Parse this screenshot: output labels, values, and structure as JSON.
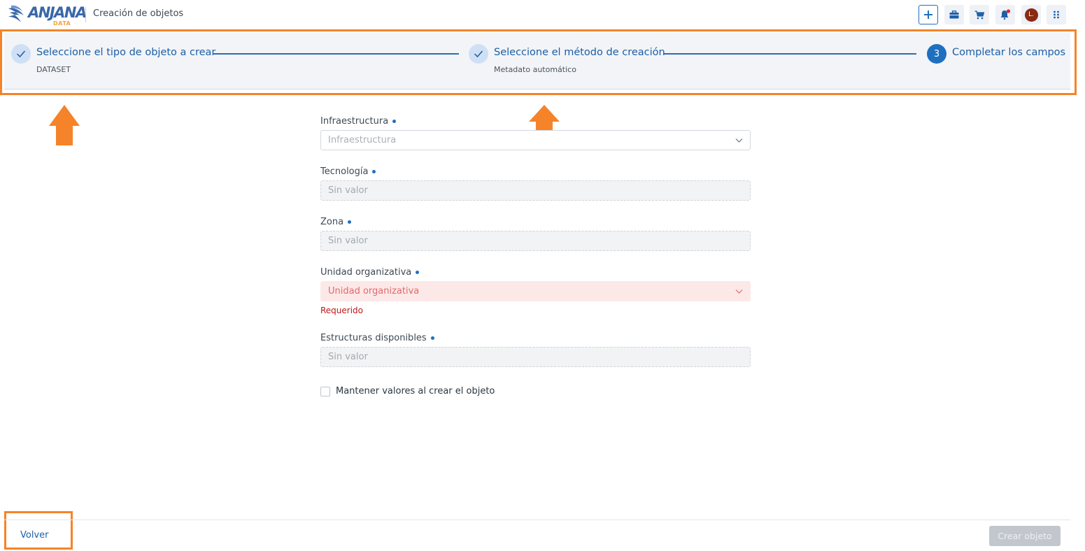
{
  "header": {
    "logo_text": "ANJANA",
    "logo_sub": "DATA",
    "title": "Creación de objetos"
  },
  "toolbar": {
    "icons": [
      "plus-icon",
      "briefcase-icon",
      "cart-icon",
      "bell-icon",
      "avatar",
      "apps-grid-icon"
    ],
    "avatar_initial": "L."
  },
  "stepper": {
    "steps": [
      {
        "label": "Seleccione el tipo de objeto a crear",
        "sub": "DATASET",
        "state": "done"
      },
      {
        "label": "Seleccione el método de creación",
        "sub": "Metadato automático",
        "state": "done"
      },
      {
        "number": "3",
        "label": "Completar los campos",
        "state": "active"
      }
    ]
  },
  "form": {
    "fields": [
      {
        "label": "Infraestructura",
        "placeholder": "Infraestructura",
        "type": "select"
      },
      {
        "label": "Tecnología",
        "placeholder": "Sin valor",
        "type": "disabled"
      },
      {
        "label": "Zona",
        "placeholder": "Sin valor",
        "type": "disabled"
      },
      {
        "label": "Unidad organizativa",
        "placeholder": "Unidad organizativa",
        "type": "select-error",
        "error": "Requerido"
      },
      {
        "label": "Estructuras disponibles",
        "placeholder": "Sin valor",
        "type": "disabled"
      }
    ],
    "keep_values_label": "Mantener valores al crear el objeto"
  },
  "footer": {
    "back_label": "Volver",
    "create_label": "Crear objeto"
  },
  "colors": {
    "accent": "#1f6fbf",
    "annotation": "#f5832a",
    "error": "#c0161b"
  }
}
